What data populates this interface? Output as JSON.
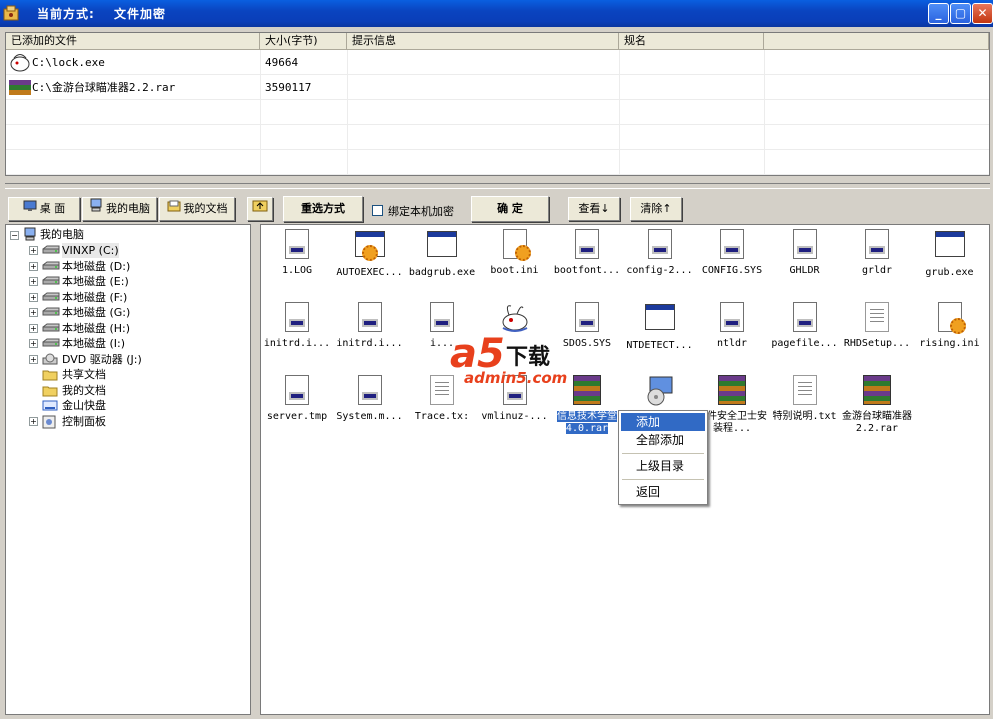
{
  "window": {
    "mode_label": "当前方式:",
    "mode_value": "文件加密",
    "minimize": "_",
    "maximize": "▢",
    "close": "✕"
  },
  "list": {
    "headers": [
      "已添加的文件",
      "大小(字节)",
      "提示信息",
      "规名"
    ],
    "rows": [
      {
        "name": "C:\\lock.exe",
        "size": "49664",
        "hint": "",
        "icon": "lock-exe-icon"
      },
      {
        "name": "C:\\金游台球瞄准器2.2.rar",
        "size": "3590117",
        "hint": "",
        "icon": "rar-archive-icon"
      }
    ]
  },
  "toolbar": {
    "desktop": "桌 面",
    "my_computer": "我的电脑",
    "my_docs": "我的文档",
    "reselect": "重选方式",
    "bind_label": "绑定本机加密",
    "bind_checked": false,
    "confirm": "确 定",
    "view": "查看↓",
    "clear": "清除↑"
  },
  "tree": {
    "root": "我的电脑",
    "nodes": [
      {
        "label": "VINXP (C:)",
        "icon": "drive-icon",
        "expand": true
      },
      {
        "label": "本地磁盘 (D:)",
        "icon": "drive-icon",
        "expand": true
      },
      {
        "label": "本地磁盘 (E:)",
        "icon": "drive-icon",
        "expand": true
      },
      {
        "label": "本地磁盘 (F:)",
        "icon": "drive-icon",
        "expand": true
      },
      {
        "label": "本地磁盘 (G:)",
        "icon": "drive-icon",
        "expand": true
      },
      {
        "label": "本地磁盘 (H:)",
        "icon": "drive-icon",
        "expand": true
      },
      {
        "label": "本地磁盘 (I:)",
        "icon": "drive-icon",
        "expand": true
      },
      {
        "label": "DVD 驱动器 (J:)",
        "icon": "dvd-drive-icon",
        "expand": true
      },
      {
        "label": "共享文档",
        "icon": "folder-icon",
        "expand": false
      },
      {
        "label": "我的文档",
        "icon": "folder-icon",
        "expand": false
      },
      {
        "label": "金山快盘",
        "icon": "cloud-disk-icon",
        "expand": false
      },
      {
        "label": "控制面板",
        "icon": "control-panel-icon",
        "expand": true
      }
    ]
  },
  "files": [
    {
      "label": "1.LOG",
      "icon": "doc"
    },
    {
      "label": "AUTOEXEC...",
      "icon": "exe-gear"
    },
    {
      "label": "badgrub.exe",
      "icon": "win"
    },
    {
      "label": "boot.ini",
      "icon": "ini"
    },
    {
      "label": "bootfont...",
      "icon": "doc"
    },
    {
      "label": "config-2...",
      "icon": "doc"
    },
    {
      "label": "CONFIG.SYS",
      "icon": "doc"
    },
    {
      "label": "GHLDR",
      "icon": "doc"
    },
    {
      "label": "grldr",
      "icon": "doc"
    },
    {
      "label": "grub.exe",
      "icon": "win"
    },
    {
      "label": "initrd.i...",
      "icon": "doc"
    },
    {
      "label": "initrd.i...",
      "icon": "doc"
    },
    {
      "label": "i...",
      "icon": "doc"
    },
    {
      "label": "",
      "icon": "rabbit"
    },
    {
      "label": "SDOS.SYS",
      "icon": "doc"
    },
    {
      "label": "NTDETECT...",
      "icon": "win"
    },
    {
      "label": "ntldr",
      "icon": "doc"
    },
    {
      "label": "pagefile...",
      "icon": "doc"
    },
    {
      "label": "RHDSetup...",
      "icon": "txt"
    },
    {
      "label": "rising.ini",
      "icon": "ini"
    },
    {
      "label": "server.tmp",
      "icon": "doc"
    },
    {
      "label": "System.m...",
      "icon": "doc"
    },
    {
      "label": "Trace.tx:",
      "icon": "txt"
    },
    {
      "label": "vmlinuz-...",
      "icon": "doc"
    },
    {
      "label": "信息技术学堂4.0.rar",
      "icon": "rar",
      "selected": true
    },
    {
      "label": "",
      "icon": "setup"
    },
    {
      "label": "文件安全卫士安装程...",
      "icon": "rar"
    },
    {
      "label": "特别说明.txt",
      "icon": "txt"
    },
    {
      "label": "金游台球瞄准器2.2.rar",
      "icon": "rar"
    }
  ],
  "context_menu": {
    "add": "添加",
    "add_all": "全部添加",
    "parent_dir": "上级目录",
    "back": "返回"
  },
  "watermark": {
    "logo": "a5",
    "text": "下载",
    "domain": "admin5.com"
  }
}
